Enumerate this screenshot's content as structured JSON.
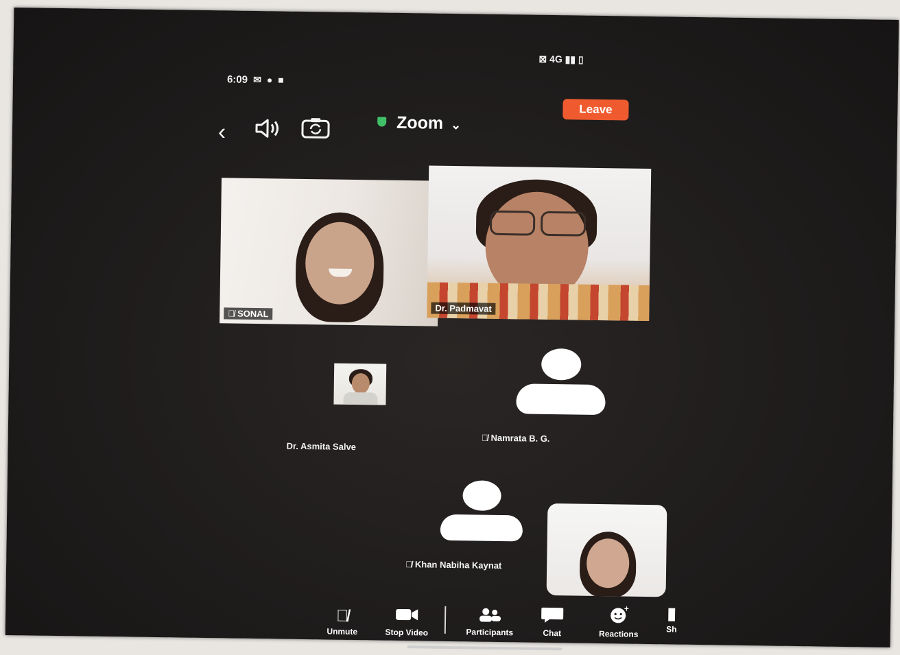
{
  "status_bar": {
    "time": "6:09",
    "left_glyphs": "✉ ● ■",
    "right_glyphs": "⊠ 4G ▮▮ ▯"
  },
  "header": {
    "app_title": "Zoom",
    "leave_label": "Leave",
    "back_icon": "chevron-left-icon",
    "speaker_icon": "speaker-icon",
    "camera_icon": "camera-flip-icon",
    "shield_icon": "shield-icon"
  },
  "participants": [
    {
      "name": "SONAL",
      "muted": true,
      "video": "on"
    },
    {
      "name": "Dr. Padmavat",
      "muted": false,
      "video": "on"
    },
    {
      "name": "Dr. Asmita Salve",
      "muted": false,
      "video": "thumbnail"
    },
    {
      "name": "Namrata B. G.",
      "muted": true,
      "video": "off"
    },
    {
      "name": "Khan Nabiha Kaynat",
      "muted": true,
      "video": "off"
    }
  ],
  "toolbar": {
    "unmute": "Unmute",
    "stop_video": "Stop Video",
    "participants": "Participants",
    "chat": "Chat",
    "reactions": "Reactions",
    "share": "Sh"
  },
  "colors": {
    "leave_button": "#ef5b2f",
    "shield": "#3fbf67",
    "background": "#1f1c1c"
  }
}
